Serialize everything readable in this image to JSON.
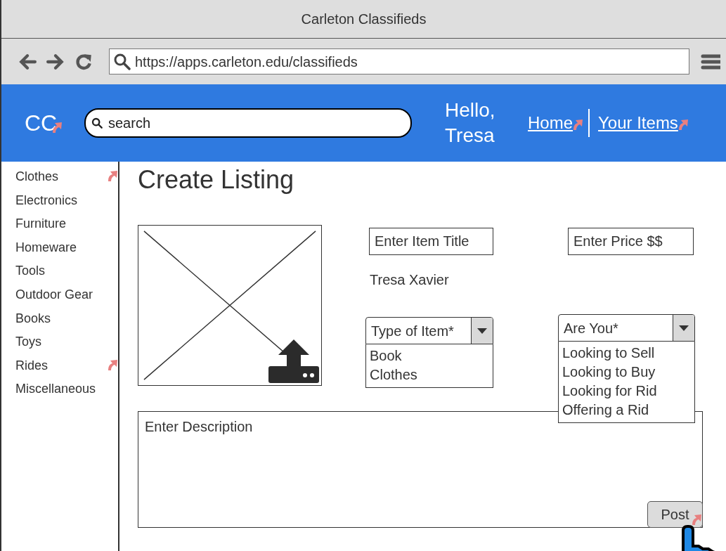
{
  "window": {
    "title": "Carleton Classifieds"
  },
  "browser": {
    "url": "https://apps.carleton.edu/classifieds"
  },
  "header": {
    "logo": "CC",
    "logo_linked": true,
    "search": {
      "placeholder": "search"
    },
    "greeting": [
      "Hello,",
      "Tresa"
    ],
    "nav": [
      {
        "label": "Home",
        "linked": true
      },
      {
        "label": "Your Items",
        "linked": true
      }
    ]
  },
  "sidebar": {
    "items": [
      {
        "label": "Clothes",
        "linked": true
      },
      {
        "label": "Electronics",
        "linked": false
      },
      {
        "label": "Furniture",
        "linked": false
      },
      {
        "label": "Homeware",
        "linked": false
      },
      {
        "label": "Tools",
        "linked": false
      },
      {
        "label": "Outdoor Gear",
        "linked": false
      },
      {
        "label": "Books",
        "linked": false
      },
      {
        "label": "Toys",
        "linked": false
      },
      {
        "label": "Rides",
        "linked": true
      },
      {
        "label": "Miscellaneous",
        "linked": false
      }
    ]
  },
  "form": {
    "heading": "Create Listing",
    "title_field": {
      "placeholder": "Enter Item Title"
    },
    "price_field": {
      "placeholder": "Enter Price $$"
    },
    "seller": "Tresa Xavier",
    "type_select": {
      "value": "Type of Item*",
      "expanded": true,
      "options": [
        "Book",
        "Clothes"
      ]
    },
    "role_select": {
      "value": "Are You*",
      "expanded": true,
      "options": [
        "Looking to Sell",
        "Looking to Buy",
        "Looking for Rid",
        "Offering a Rid"
      ]
    },
    "description": {
      "placeholder": "Enter Description"
    },
    "post_button": {
      "label": "Post",
      "linked": true
    }
  }
}
